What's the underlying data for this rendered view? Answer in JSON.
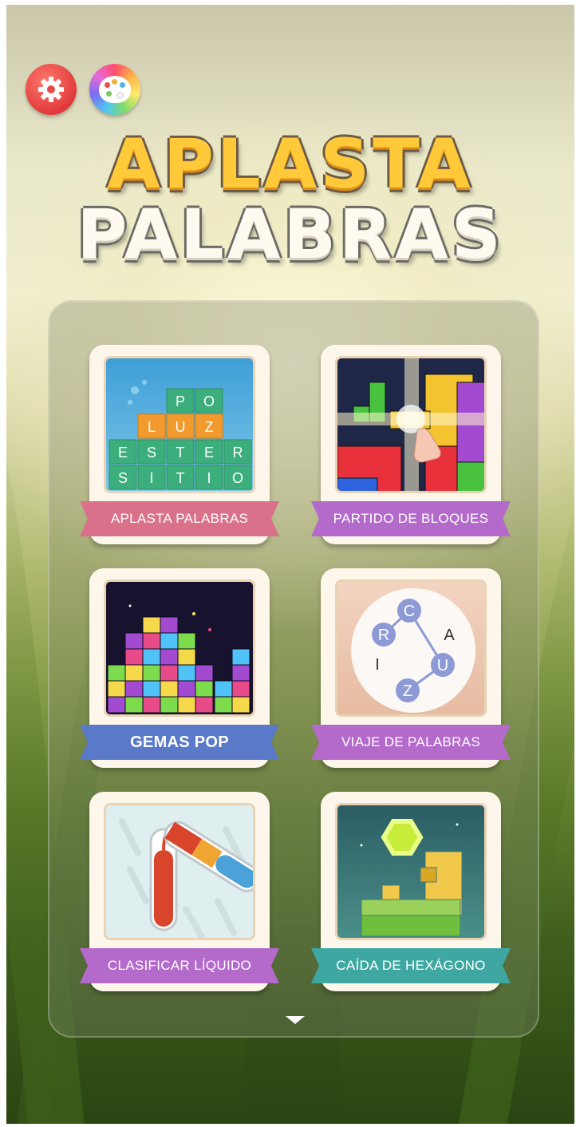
{
  "app": {
    "title_line1": "APLASTA",
    "title_line2": "PALABRAS"
  },
  "top_buttons": [
    {
      "name": "settings",
      "icon": "gear-icon",
      "color": "#e03a3a"
    },
    {
      "name": "theme",
      "icon": "palette-icon",
      "color": "rainbow"
    }
  ],
  "games": [
    {
      "label": "APLASTA PALABRAS",
      "ribbon_color": "#d9718a",
      "words": [
        [
          "P",
          "O"
        ],
        [
          "L",
          "U",
          "Z"
        ],
        [
          "E",
          "S",
          "T",
          "E",
          "R"
        ],
        [
          "S",
          "I",
          "T",
          "I",
          "O"
        ]
      ]
    },
    {
      "label": "PARTIDO DE BLOQUES",
      "ribbon_color": "#b36acb"
    },
    {
      "label": "GEMAS POP",
      "ribbon_color": "#5a79c9"
    },
    {
      "label": "VIAJE DE PALABRAS",
      "ribbon_color": "#b36acb",
      "letters": [
        "C",
        "R",
        "A",
        "I",
        "U",
        "Z"
      ]
    },
    {
      "label": "CLASIFICAR LÍQUIDO",
      "ribbon_color": "#b36acb"
    },
    {
      "label": "CAÍDA DE HEXÁGONO",
      "ribbon_color": "#3fa7a2"
    }
  ],
  "scroll_indicator": "arrow-down-icon"
}
